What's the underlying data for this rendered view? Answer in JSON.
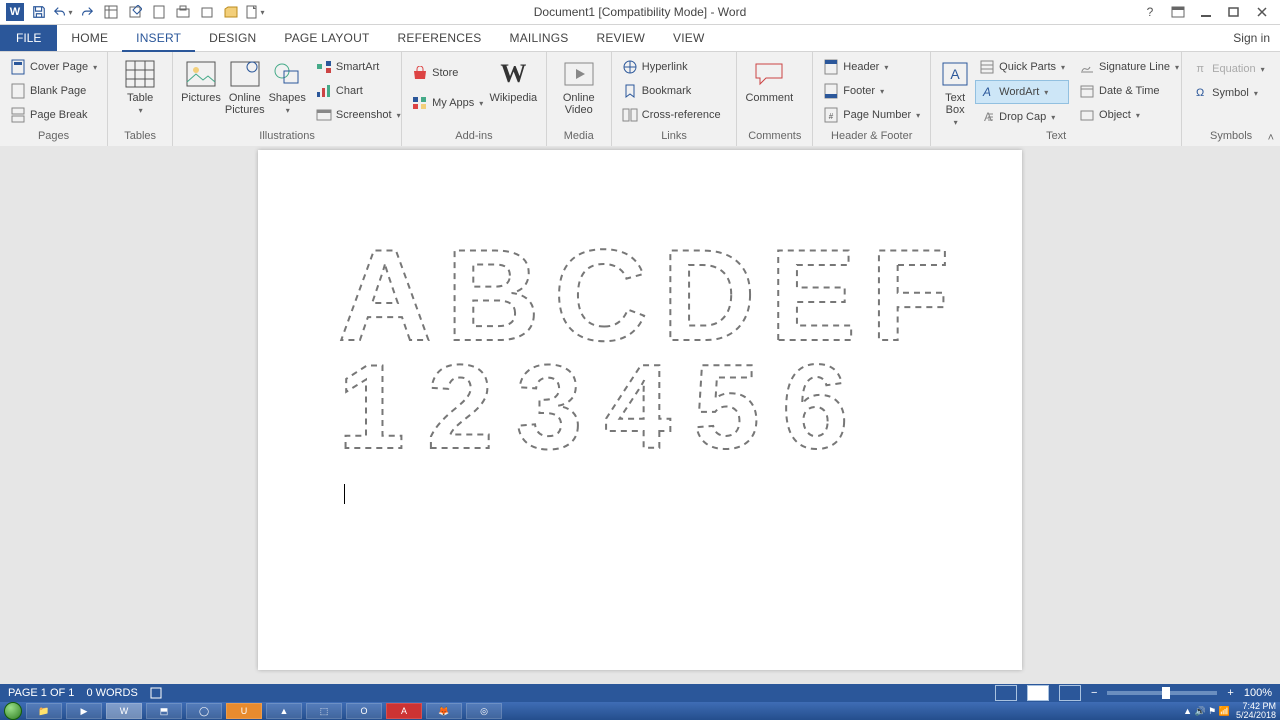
{
  "title": "Document1 [Compatibility Mode] - Word",
  "signin": "Sign in",
  "qat_icons": [
    "word",
    "save",
    "undo",
    "redo",
    "table",
    "edit",
    "doc",
    "print",
    "box",
    "folder",
    "newdoc"
  ],
  "tabs": [
    {
      "label": "FILE",
      "kind": "file"
    },
    {
      "label": "HOME"
    },
    {
      "label": "INSERT",
      "active": true
    },
    {
      "label": "DESIGN"
    },
    {
      "label": "PAGE LAYOUT"
    },
    {
      "label": "REFERENCES"
    },
    {
      "label": "MAILINGS"
    },
    {
      "label": "REVIEW"
    },
    {
      "label": "VIEW"
    }
  ],
  "ribbon": {
    "pages": {
      "label": "Pages",
      "items": [
        "Cover Page",
        "Blank Page",
        "Page Break"
      ]
    },
    "tables": {
      "label": "Tables",
      "big": "Table"
    },
    "illus": {
      "label": "Illustrations",
      "bigs": [
        "Pictures",
        "Online Pictures",
        "Shapes"
      ],
      "smalls": [
        "SmartArt",
        "Chart",
        "Screenshot"
      ]
    },
    "addins": {
      "label": "Add-ins",
      "smalls": [
        "Store",
        "My Apps"
      ],
      "big": "Wikipedia"
    },
    "media": {
      "label": "Media",
      "big": "Online Video"
    },
    "links": {
      "label": "Links",
      "items": [
        "Hyperlink",
        "Bookmark",
        "Cross-reference"
      ]
    },
    "comments": {
      "label": "Comments",
      "big": "Comment"
    },
    "hf": {
      "label": "Header & Footer",
      "items": [
        "Header",
        "Footer",
        "Page Number"
      ]
    },
    "text": {
      "label": "Text",
      "big": "Text Box",
      "col1": [
        "Quick Parts",
        "WordArt",
        "Drop Cap"
      ],
      "col2": [
        "Signature Line",
        "Date & Time",
        "Object"
      ]
    },
    "symbols": {
      "label": "Symbols",
      "items": [
        "Equation",
        "Symbol"
      ]
    }
  },
  "document": {
    "line1": "ABCDEF",
    "line2": "123456"
  },
  "status": {
    "page": "PAGE 1 OF 1",
    "words": "0 WORDS",
    "zoom": "100%"
  },
  "tray": {
    "time": "7:42 PM",
    "date": "5/24/2018"
  }
}
